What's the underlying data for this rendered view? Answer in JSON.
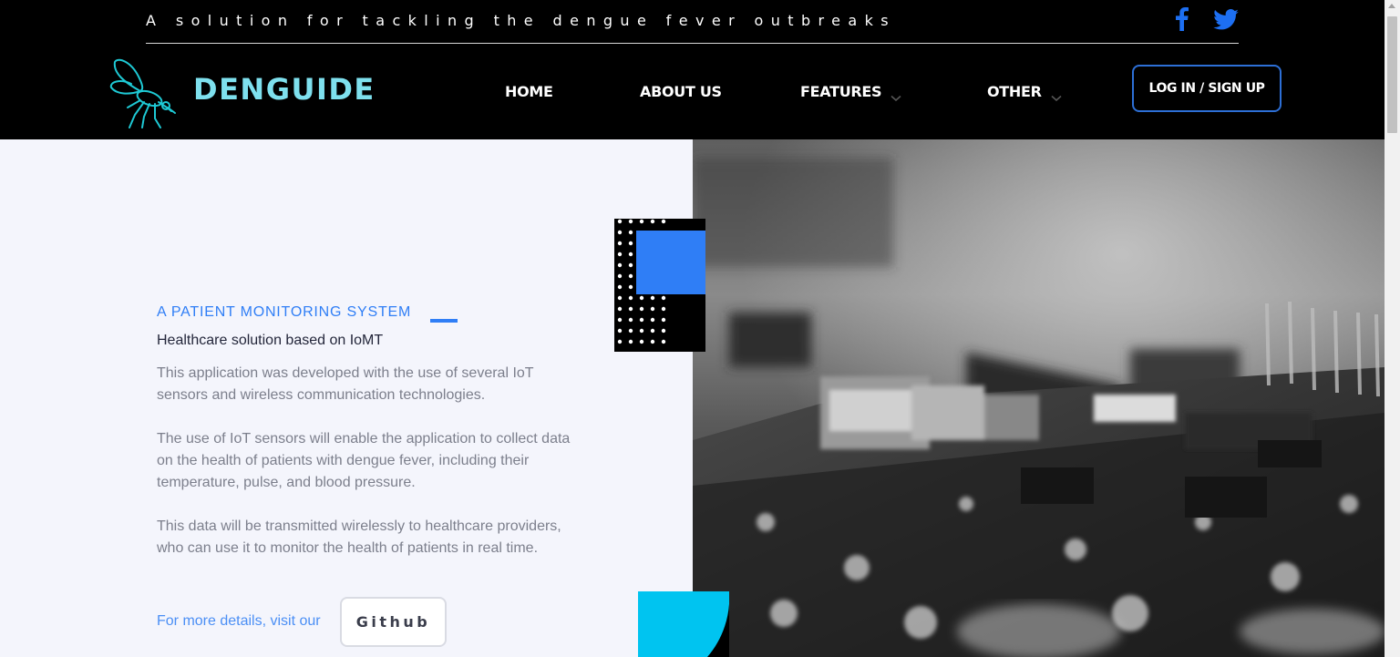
{
  "header": {
    "tagline": "A solution for tackling the dengue fever outbreaks",
    "brand": "DENGUIDE",
    "social": [
      "facebook-icon",
      "twitter-icon"
    ],
    "nav": [
      {
        "label": "HOME",
        "dropdown": false
      },
      {
        "label": "ABOUT US",
        "dropdown": false
      },
      {
        "label": "FEATURES",
        "dropdown": true
      },
      {
        "label": "OTHER",
        "dropdown": true
      }
    ],
    "login_label": "LOG IN / SIGN UP"
  },
  "hero": {
    "eyebrow": "A PATIENT MONITORING SYSTEM",
    "subtitle": "Healthcare solution based on IoMT",
    "paragraphs": [
      "This application was developed with the use of several IoT sensors and wireless communication technologies.",
      "The use of IoT sensors will enable the application to collect data on the health of patients with dengue fever, including their temperature, pulse, and blood pressure.",
      "This data will be transmitted wirelessly to healthcare providers, who can use it to monitor the health of patients in real time."
    ],
    "more_text": "For more details, visit our",
    "github_label": "Github",
    "image": "grayscale-circuit-board-photo"
  },
  "colors": {
    "header_bg": "#000000",
    "brand": "#7ee0ee",
    "accent_blue": "#2f7ef6",
    "social_blue": "#1d6ff2",
    "cyan": "#00c4f0",
    "page_bg": "#f4f5fc"
  }
}
